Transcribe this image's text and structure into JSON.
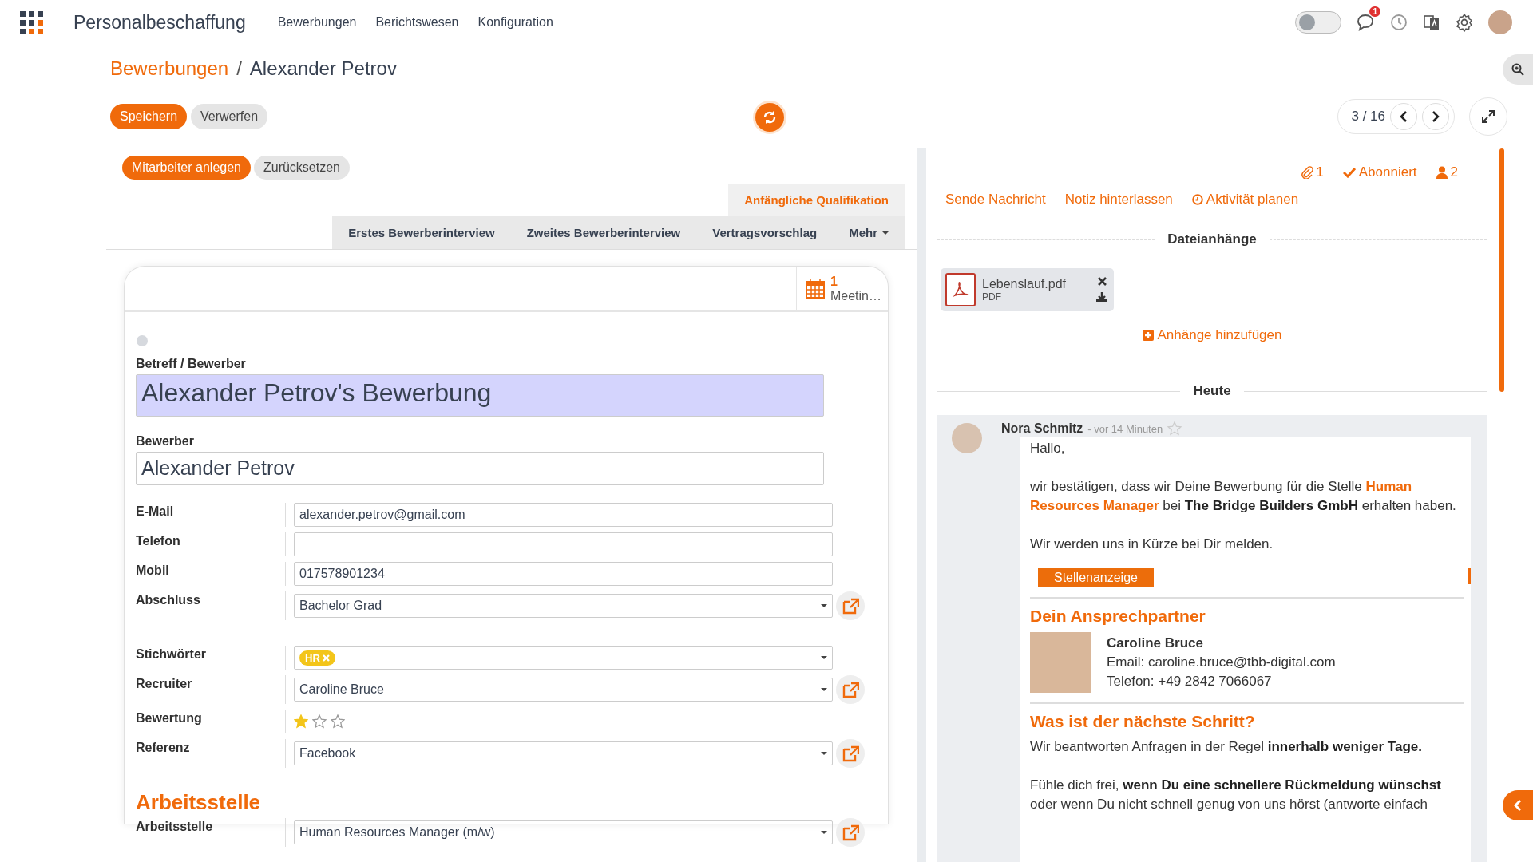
{
  "app": {
    "title": "Personalbeschaffung",
    "menu": [
      "Bewerbungen",
      "Berichtswesen",
      "Konfiguration"
    ],
    "dark_mode_on": false,
    "notification_count": "1"
  },
  "breadcrumb": {
    "parent": "Bewerbungen",
    "separator": "/",
    "current": "Alexander Petrov"
  },
  "actions": [
    {
      "label": "Speichern",
      "kind": "primary"
    },
    {
      "label": "Verwerfen",
      "kind": "secondary"
    }
  ],
  "pager": {
    "text": "3 / 16"
  },
  "header_buttons": [
    {
      "label": "Mitarbeiter anlegen",
      "kind": "primary"
    },
    {
      "label": "Zurücksetzen",
      "kind": "secondary"
    }
  ],
  "stages": [
    {
      "label": "Anfängliche Qualifikation",
      "selected": true
    },
    {
      "label": "Erstes Bewerberinterview",
      "selected": false
    },
    {
      "label": "Zweites Bewerberinterview",
      "selected": false
    },
    {
      "label": "Vertragsvorschlag",
      "selected": false
    }
  ],
  "stages_more": "Mehr",
  "meeting_button": {
    "count": "1",
    "label": "Meetin…"
  },
  "form": {
    "status_dot": {
      "color": "#d6d9de"
    },
    "subject": {
      "label": "Betreff / Bewerber",
      "value": "Alexander Petrov's Bewerbung",
      "focused": true
    },
    "applicant": {
      "label": "Bewerber",
      "value": "Alexander Petrov"
    },
    "groups": [
      [
        {
          "label": "E-Mail",
          "kind": "text",
          "value": "alexander.petrov@gmail.com"
        },
        {
          "label": "Telefon",
          "kind": "text"
        },
        {
          "label": "Mobil",
          "kind": "text",
          "value": "017578901234"
        },
        {
          "label": "Abschluss",
          "kind": "select",
          "value": "Bachelor Grad",
          "external_link": true
        }
      ],
      [
        {
          "label": "Stichwörter",
          "kind": "tags",
          "tags": [
            "HR"
          ]
        },
        {
          "label": "Recruiter",
          "kind": "select",
          "value": "Caroline Bruce",
          "external_link": true
        },
        {
          "label": "Bewertung",
          "kind": "stars",
          "stars": 1
        },
        {
          "label": "Referenz",
          "kind": "select",
          "value": "Facebook",
          "external_link": true
        }
      ]
    ],
    "section": {
      "title": "Arbeitsstelle",
      "fields": [
        {
          "label": "Arbeitsstelle",
          "kind": "select",
          "value": "Human Resources Manager (m/w)",
          "external_link": true
        }
      ]
    }
  },
  "chatter": {
    "attachment_count": "1",
    "subscribed": true,
    "subscribed_label": "Abonniert",
    "follower_count": "2",
    "actions": [
      {
        "label": "Sende Nachricht",
        "kind": "message"
      },
      {
        "label": "Notiz hinterlassen",
        "kind": "note"
      },
      {
        "label": "Aktivität planen",
        "kind": "activity"
      }
    ],
    "attachments": {
      "title": "Dateianhänge",
      "files": [
        {
          "name": "Lebenslauf.pdf",
          "type": "PDF"
        }
      ],
      "add_label": "Anhänge hinzufügen"
    },
    "day_separator": "Heute",
    "messages": [
      {
        "author": "Nora Schmitz",
        "time": "- vor 14 Minuten",
        "starred": false,
        "body": [
          {
            "kind": "paragraph",
            "segments": [
              {
                "text": "Hallo,"
              }
            ]
          },
          {
            "kind": "paragraph",
            "segments": [
              {
                "text": "wir bestätigen, dass wir Deine Bewerbung für die Stelle "
              },
              {
                "text": "Human Resources Manager",
                "accent": true
              },
              {
                "text": " bei "
              },
              {
                "text": "The Bridge Builders GmbH",
                "bold": true
              },
              {
                "text": " erhalten haben."
              }
            ]
          },
          {
            "kind": "paragraph",
            "segments": [
              {
                "text": "Wir werden uns in Kürze bei Dir melden."
              }
            ]
          },
          {
            "kind": "button",
            "label": "Stellenanzeige"
          },
          {
            "kind": "divider"
          },
          {
            "kind": "heading",
            "text": "Dein Ansprechpartner"
          },
          {
            "kind": "contact",
            "name": "Caroline Bruce",
            "email": "Email: caroline.bruce@tbb-digital.com",
            "phone": "Telefon: +49 2842 7066067"
          },
          {
            "kind": "divider"
          },
          {
            "kind": "heading",
            "text": "Was ist der nächste Schritt?"
          },
          {
            "kind": "paragraph",
            "segments": [
              {
                "text": "Wir beantworten Anfragen in der Regel "
              },
              {
                "text": "innerhalb weniger Tage.",
                "bold": true
              }
            ]
          },
          {
            "kind": "paragraph",
            "segments": [
              {
                "text": "Fühle dich frei, "
              },
              {
                "text": "wenn Du eine schnellere Rückmeldung wünschst",
                "bold": true
              },
              {
                "text": " oder wenn Du nicht schnell genug von uns hörst (antworte einfach"
              }
            ]
          }
        ]
      }
    ]
  }
}
